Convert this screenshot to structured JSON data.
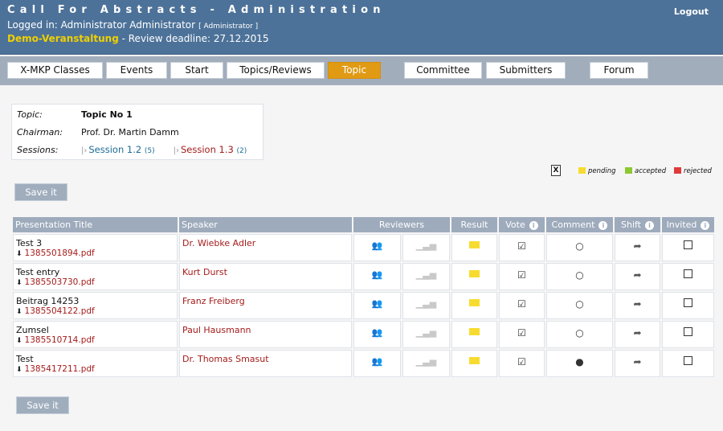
{
  "header": {
    "title": "Call For Abstracts - Administration",
    "logged_prefix": "Logged in: Administrator Administrator",
    "role": "[ Administrator ]",
    "event_name": "Demo-Veranstaltung",
    "deadline": " - Review deadline: 27.12.2015",
    "logout": "Logout"
  },
  "nav": {
    "items": [
      "X-MKP Classes",
      "Events",
      "Start",
      "Topics/Reviews",
      "Topic",
      "Committee",
      "Submitters",
      "Forum"
    ],
    "active": "Topic"
  },
  "topic": {
    "topic_label": "Topic:",
    "topic_value": "Topic No 1",
    "chair_label": "Chairman:",
    "chair_value": "Prof. Dr. Martin Damm",
    "sessions_label": "Sessions:",
    "sessions": [
      {
        "name": "Session 1.2",
        "count": "(5)"
      },
      {
        "name": "Session 1.3",
        "count": "(2)"
      }
    ]
  },
  "legend": {
    "pending": "pending",
    "accepted": "accepted",
    "rejected": "rejected",
    "colors": {
      "pending": "#f7dc2f",
      "accepted": "#8cc832",
      "rejected": "#e03a3a"
    }
  },
  "save_label": "Save it",
  "table": {
    "headers": {
      "title": "Presentation Title",
      "speaker": "Speaker",
      "reviewers": "Reviewers",
      "result": "Result",
      "vote": "Vote",
      "comment": "Comment",
      "shift": "Shift",
      "invited": "Invited"
    },
    "rows": [
      {
        "title": "Test 3",
        "file": "1385501894.pdf",
        "speaker": "Dr. Wiebke Adler",
        "result": "pending",
        "comment_filled": false
      },
      {
        "title": "Test entry",
        "file": "1385503730.pdf",
        "speaker": "Kurt Durst",
        "result": "pending",
        "comment_filled": false
      },
      {
        "title": "Beitrag 14253",
        "file": "1385504122.pdf",
        "speaker": "Franz Freiberg",
        "result": "pending",
        "comment_filled": false
      },
      {
        "title": "Zumsel",
        "file": "1385510714.pdf",
        "speaker": "Paul Hausmann",
        "result": "pending",
        "comment_filled": false
      },
      {
        "title": "Test",
        "file": "1385417211.pdf",
        "speaker": "Dr. Thomas Smasut",
        "result": "pending",
        "comment_filled": true
      }
    ]
  }
}
